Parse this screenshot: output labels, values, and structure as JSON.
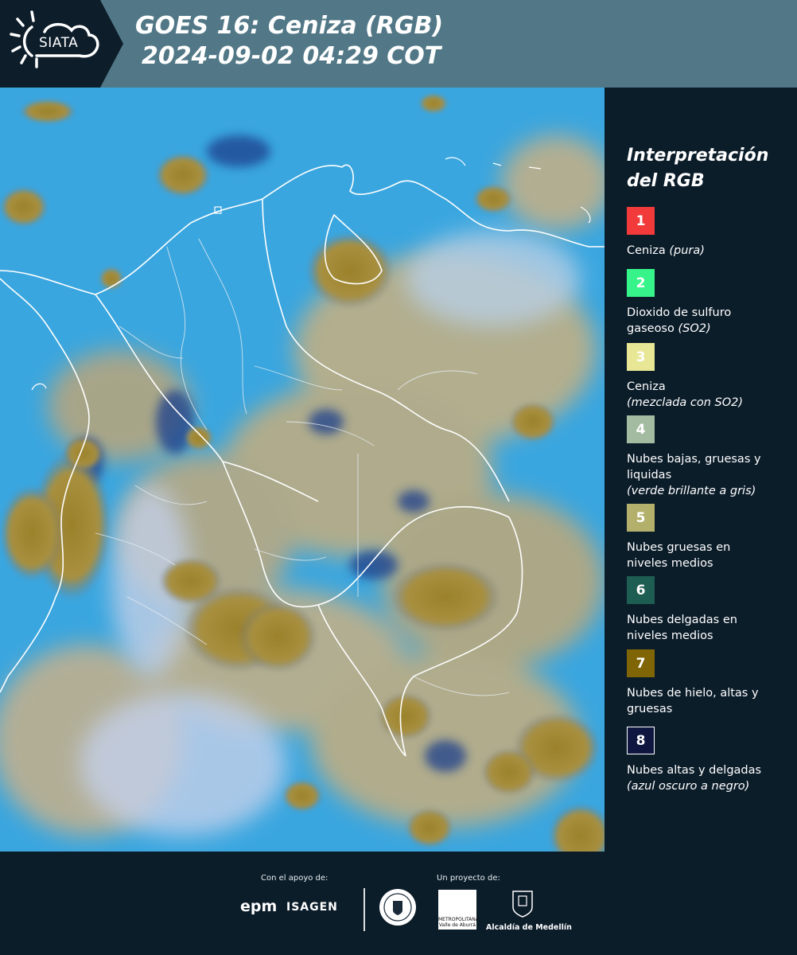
{
  "header": {
    "logo_text": "SIATA",
    "title_line1": "GOES 16: Ceniza (RGB)",
    "title_line2": "2024-09-02 04:29 COT"
  },
  "legend": {
    "title_line1": "Interpretación",
    "title_line2": "del RGB",
    "items": [
      {
        "number": "1",
        "color": "#f23a3a",
        "text_color": "#ffffff",
        "line1": "Ceniza",
        "line1_italic": "(pura)",
        "line2": "",
        "line3_italic": ""
      },
      {
        "number": "2",
        "color": "#37f48a",
        "text_color": "#ffffff",
        "line1": "Dioxido de sulfuro",
        "line1_italic": "",
        "line2": "gaseoso",
        "line2_italic": "(SO2)"
      },
      {
        "number": "3",
        "color": "#e8e796",
        "text_color": "#ffffff",
        "line1": "Ceniza",
        "line1_italic": "",
        "line2": "",
        "line2_italic": "(mezclada con SO2)"
      },
      {
        "number": "4",
        "color": "#a3bba0",
        "text_color": "#ffffff",
        "line1": "Nubes bajas, gruesas y",
        "line1_italic": "",
        "line2": "liquidas",
        "line2_italic": "",
        "line3_italic": "(verde brillante a gris)"
      },
      {
        "number": "5",
        "color": "#b2b06a",
        "text_color": "#ffffff",
        "line1": "Nubes gruesas en",
        "line1_italic": "",
        "line2": "niveles medios",
        "line2_italic": ""
      },
      {
        "number": "6",
        "color": "#1e5e52",
        "text_color": "#ffffff",
        "line1": "Nubes delgadas en",
        "line1_italic": "",
        "line2": "niveles medios",
        "line2_italic": ""
      },
      {
        "number": "7",
        "color": "#7f6506",
        "text_color": "#ffffff",
        "line1": "Nubes de hielo, altas y",
        "line1_italic": "",
        "line2": "gruesas",
        "line2_italic": ""
      },
      {
        "number": "8",
        "color": "#0f1640",
        "text_color": "#ffffff",
        "line1": "Nubes altas y delgadas",
        "line1_italic": "",
        "line2": "",
        "line2_italic": "(azul oscuro a negro)"
      }
    ]
  },
  "footer": {
    "support_label": "Con el apoyo de:",
    "project_label": "Un proyecto de:",
    "epm": "epm",
    "isagen": "ISAGEN",
    "area_text": "METROPOLITANA",
    "area_sub": "Valle de Aburrá",
    "alcaldia": "Alcaldía de Medellín"
  },
  "colors": {
    "header_bg": "#527887",
    "panel_bg": "#0c1d2a",
    "map_sea": "#3aa6df",
    "cloud_high_thick": "#9b8530",
    "cloud_mid": "#c8b27e",
    "cloud_thin": "#b9cce4",
    "border": "#ffffff"
  }
}
